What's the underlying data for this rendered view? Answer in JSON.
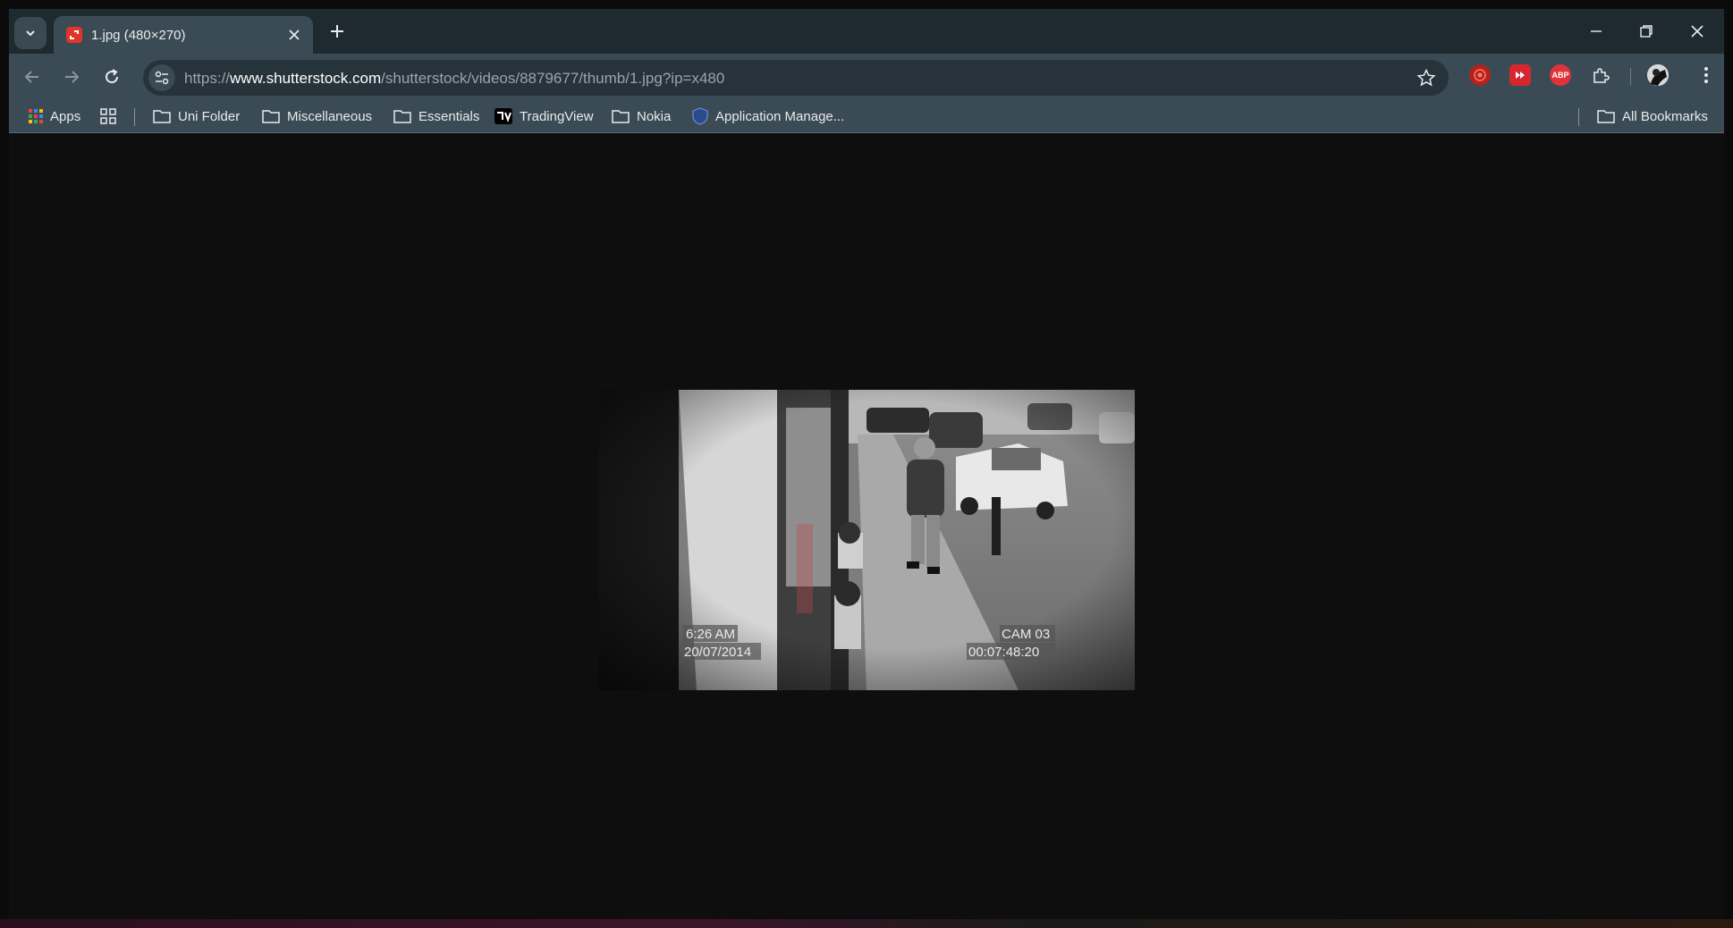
{
  "browser": {
    "tab": {
      "title": "1.jpg (480×270)"
    },
    "url": {
      "scheme": "https://",
      "host": "www.shutterstock.com",
      "path": "/shutterstock/videos/8879677/thumb/1.jpg?ip=x480"
    },
    "extensions": [
      "record-icon",
      "media-forward-icon",
      "adblock-plus-icon",
      "puzzle-piece-icon"
    ],
    "extension_abp_label": "ABP"
  },
  "bookmarks": {
    "apps_label": "Apps",
    "items": [
      {
        "label": "Uni Folder",
        "icon": "folder-icon"
      },
      {
        "label": "Miscellaneous",
        "icon": "folder-icon"
      },
      {
        "label": "Essentials",
        "icon": "folder-icon"
      },
      {
        "label": "TradingView",
        "icon": "tradingview-icon"
      },
      {
        "label": "Nokia",
        "icon": "folder-icon"
      },
      {
        "label": "Application Manage...",
        "icon": "shield-icon"
      }
    ],
    "all_bookmarks_label": "All Bookmarks"
  },
  "image": {
    "overlay_time": "6:26 AM",
    "overlay_date": "20/07/2014",
    "overlay_cam": "CAM 03",
    "overlay_timecode": "00:07:48:20"
  },
  "colors": {
    "frame": "#1f2a30",
    "toolbar": "#3b4b55",
    "omnibox": "#26333a",
    "page_background": "#0e0e0e"
  }
}
